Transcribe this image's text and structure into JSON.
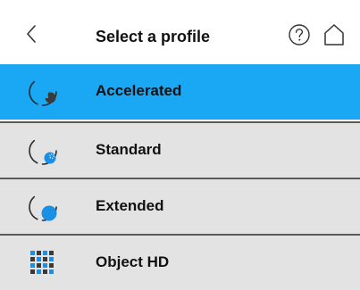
{
  "header": {
    "title": "Select a profile",
    "back_icon": "chevron-left-icon",
    "help_icon": "help-circle-icon",
    "home_icon": "home-icon"
  },
  "colors": {
    "selected_bg": "#1aa7f4",
    "item_bg": "#e3e3e3",
    "accent_blue": "#1a8fe6",
    "icon_dark": "#3a3a3a"
  },
  "profiles": [
    {
      "label": "Accelerated",
      "selected": true,
      "icon": "accelerated-profile-icon"
    },
    {
      "label": "Standard",
      "selected": false,
      "icon": "standard-profile-icon"
    },
    {
      "label": "Extended",
      "selected": false,
      "icon": "extended-profile-icon"
    },
    {
      "label": "Object HD",
      "selected": false,
      "icon": "object-hd-grid-icon"
    }
  ]
}
